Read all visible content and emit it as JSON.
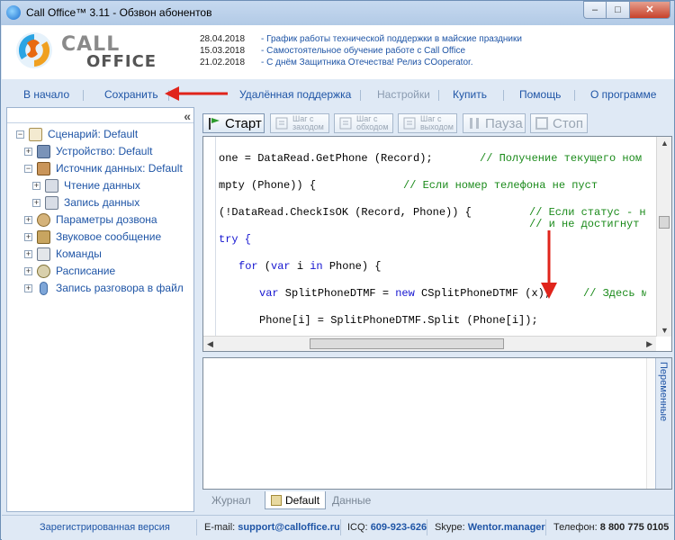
{
  "window": {
    "title": "Call Office™ 3.11 - Обзвон абонентов",
    "controls": {
      "minimize": "–",
      "maximize": "□",
      "close": "✕"
    }
  },
  "logo": {
    "line1": "CALL",
    "line2": "OFFICE",
    "tm": "™"
  },
  "news": [
    {
      "date": "28.04.2018",
      "text": "- График работы технической поддержки в майские праздники"
    },
    {
      "date": "15.03.2018",
      "text": "- Самостоятельное обучение работе с Call Office"
    },
    {
      "date": "21.02.2018",
      "text": "- С днём Защитника Отечества! Релиз COoperator."
    }
  ],
  "menu": {
    "start": "В начало",
    "save": "Сохранить",
    "remote": "Удалённая поддержка",
    "settings": "Настройки",
    "buy": "Купить",
    "help": "Помощь",
    "about": "О программе"
  },
  "tree": {
    "collapse": "«",
    "items": [
      {
        "label": "Сценарий: Default",
        "icon": "script-icon",
        "expander": "−"
      },
      {
        "label": "Устройство: Default",
        "icon": "device-icon",
        "expander": "+"
      },
      {
        "label": "Источник данных: Default",
        "icon": "datasource-icon",
        "expander": "−"
      },
      {
        "label": "Чтение данных",
        "icon": "read-data-icon",
        "expander": "+"
      },
      {
        "label": "Запись данных",
        "icon": "write-data-icon",
        "expander": "+"
      },
      {
        "label": "Параметры дозвона",
        "icon": "gear-icon",
        "expander": "+"
      },
      {
        "label": "Звуковое сообщение",
        "icon": "speaker-icon",
        "expander": "+"
      },
      {
        "label": "Команды",
        "icon": "commands-icon",
        "expander": "+"
      },
      {
        "label": "Расписание",
        "icon": "clock-icon",
        "expander": "+"
      },
      {
        "label": "Запись разговора в файл",
        "icon": "microphone-icon",
        "expander": "+"
      }
    ]
  },
  "toolbar": {
    "start": "Старт",
    "step_in_1": "Шаг с",
    "step_in_2": "заходом",
    "step_over_1": "Шаг с",
    "step_over_2": "обходом",
    "step_out_1": "Шаг с",
    "step_out_2": "выходом",
    "pause": "Пауза",
    "stop": "Стоп"
  },
  "code": {
    "l1a": "one = DataRead.GetPhone (Record);",
    "l1b": "// Получение текущего ном",
    "l2a": "mpty (Phone)) {",
    "l2b": "// Если номер телефона не пуст",
    "l3a": "(!DataRead.CheckIsOK (Record, Phone)) {",
    "l3b": "// Если статус - н",
    "l3c": "// и не достигнут",
    "l4": "try {",
    "l5a": "for",
    "l5b": " (",
    "l5c": "var",
    "l5d": " i ",
    "l5e": "in",
    "l5f": " Phone) {",
    "l6a": "var",
    "l6b": " SplitPhoneDTMF = ",
    "l6c": "new",
    "l6d": " CSplitPhoneDTMF (x);",
    "l6e": "// Здесь м",
    "l7": "Phone[i] = SplitPhoneDTMF.Split (Phone[i]);"
  },
  "output": {
    "vars_tab": "Переменные"
  },
  "bottom_tabs": {
    "journal": "Журнал",
    "default": "Default",
    "data": "Данные"
  },
  "status": {
    "registered": "Зарегистрированная версия",
    "email_label": "E-mail:",
    "email": "support@calloffice.ru",
    "icq_label": "ICQ:",
    "icq": "609-923-626",
    "skype_label": "Skype:",
    "skype": "Wentor.manager",
    "phone_label": "Телефон:",
    "phone": "8 800 775 0105"
  },
  "colors": {
    "accent": "#1f55a6",
    "arrow": "#e0241b",
    "keyword": "#1414d0",
    "comment": "#1a8a1a"
  }
}
